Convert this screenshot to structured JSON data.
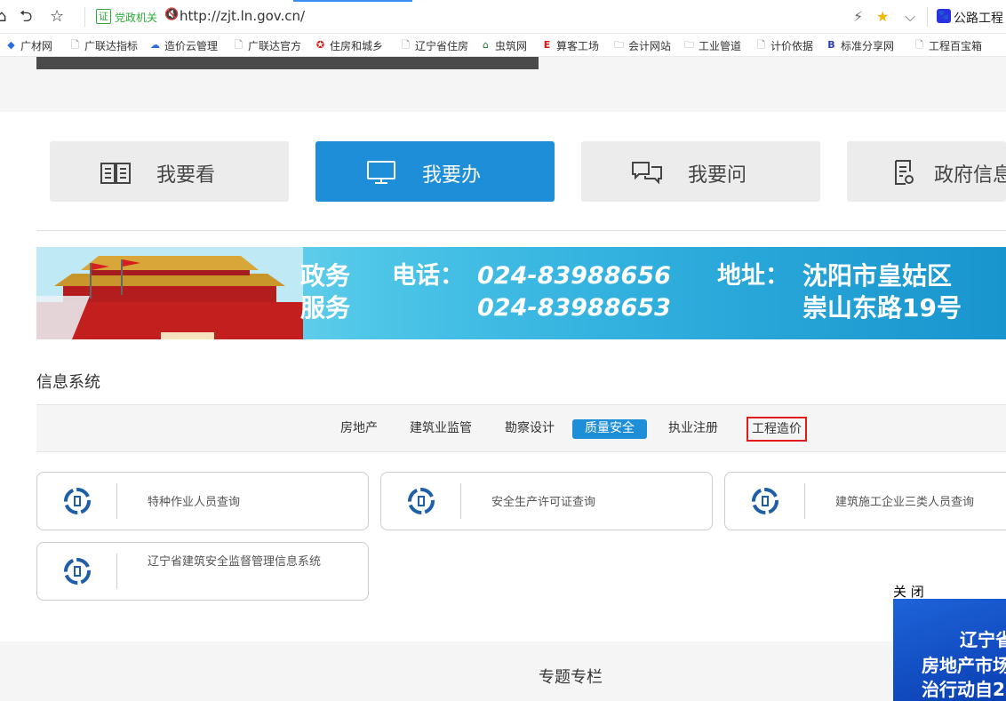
{
  "browser": {
    "nav_icons": [
      "home-icon",
      "undo-icon",
      "star-outline-icon"
    ],
    "secure_badge": "证",
    "secure_label": "党政机关",
    "url": "http://zjt.ln.gov.cn/",
    "search_engine_label": "公路工程",
    "accent": "#3b8ff3"
  },
  "bookmarks": [
    {
      "label": "广材网",
      "icon": "diamond-icon"
    },
    {
      "label": "广联达指标",
      "icon": "page-icon"
    },
    {
      "label": "造价云管理",
      "icon": "cloud-icon"
    },
    {
      "label": "广联达官方",
      "icon": "page-icon"
    },
    {
      "label": "住房和城乡",
      "icon": "emblem-icon"
    },
    {
      "label": "辽宁省住房",
      "icon": "page-icon"
    },
    {
      "label": "虫筑网",
      "icon": "house-icon"
    },
    {
      "label": "算客工场",
      "icon": "ek-icon"
    },
    {
      "label": "会计网站",
      "icon": "folder-icon"
    },
    {
      "label": "工业管道",
      "icon": "folder-icon"
    },
    {
      "label": "计价依据",
      "icon": "page-icon"
    },
    {
      "label": "标准分享网",
      "icon": "bi-icon"
    },
    {
      "label": "工程百宝箱",
      "icon": "page-icon"
    }
  ],
  "quick_actions": [
    {
      "label": "我要看",
      "icon": "book-icon",
      "active": false
    },
    {
      "label": "我要办",
      "icon": "monitor-icon",
      "active": true
    },
    {
      "label": "我要问",
      "icon": "chat-icon",
      "active": false
    },
    {
      "label": "政府信息",
      "icon": "document-icon",
      "active": false
    }
  ],
  "banner": {
    "left_line1": "政务",
    "left_line2": "服务",
    "phone_label": "电话：",
    "phone1": "024-83988656",
    "phone2": "024-83988653",
    "address_label": "地址：",
    "address1": "沈阳市皇姑区",
    "address2": "崇山东路19号"
  },
  "info_system": {
    "title": "信息系统",
    "tabs": [
      {
        "label": "房地产",
        "active": false,
        "boxed": false
      },
      {
        "label": "建筑业监管",
        "active": false,
        "boxed": false
      },
      {
        "label": "勘察设计",
        "active": false,
        "boxed": false
      },
      {
        "label": "质量安全",
        "active": true,
        "boxed": false
      },
      {
        "label": "执业注册",
        "active": false,
        "boxed": false
      },
      {
        "label": "工程造价",
        "active": false,
        "boxed": true
      }
    ],
    "cards": [
      {
        "label": "特种作业人员查询"
      },
      {
        "label": "安全生产许可证查询"
      },
      {
        "label": "建筑施工企业三类人员查询"
      },
      {
        "label": "辽宁省建筑安全监督管理信息系统"
      }
    ]
  },
  "special_column": {
    "title": "专题专栏"
  },
  "float_ad": {
    "close_label": "关 闭",
    "line1": "辽宁省",
    "line2": "房地产市场",
    "line3": "治行动自2"
  },
  "colors": {
    "primary_blue": "#1f8ed8",
    "highlight_red": "#e01c1c"
  }
}
